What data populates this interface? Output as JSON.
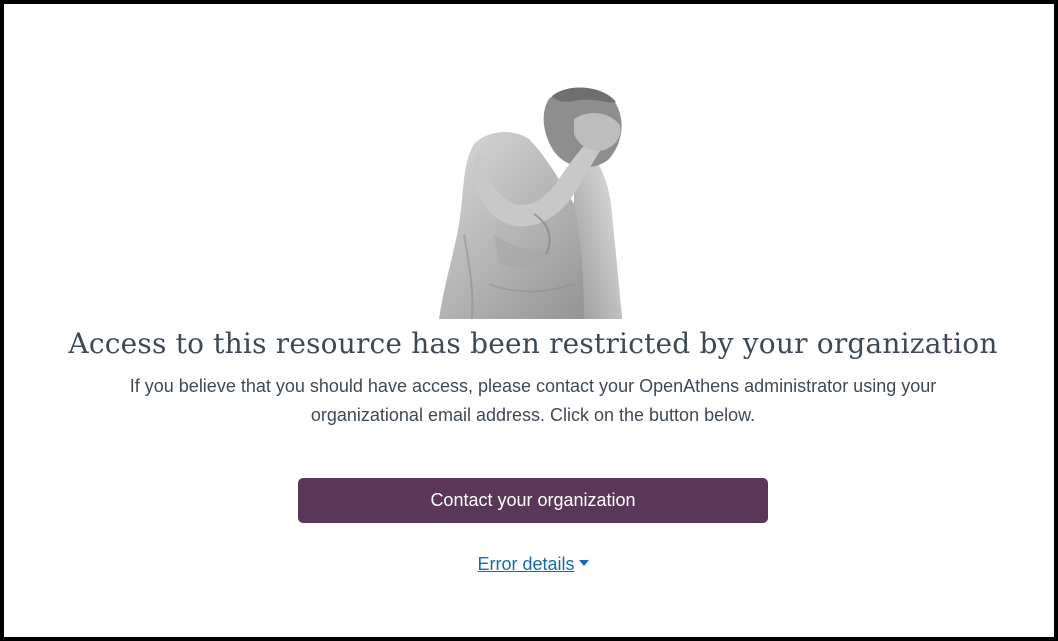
{
  "illustration": {
    "name": "facepalm-statue"
  },
  "heading": "Access to this resource has been restricted by your organization",
  "message": "If you believe that you should have access, please contact your OpenAthens administrator using your organizational email address. Click on the button below.",
  "contact_button": "Contact your organization",
  "error_details_link": "Error details",
  "colors": {
    "button_bg": "#5a3658",
    "link": "#1a6aa3",
    "heading": "#3d4a55"
  }
}
